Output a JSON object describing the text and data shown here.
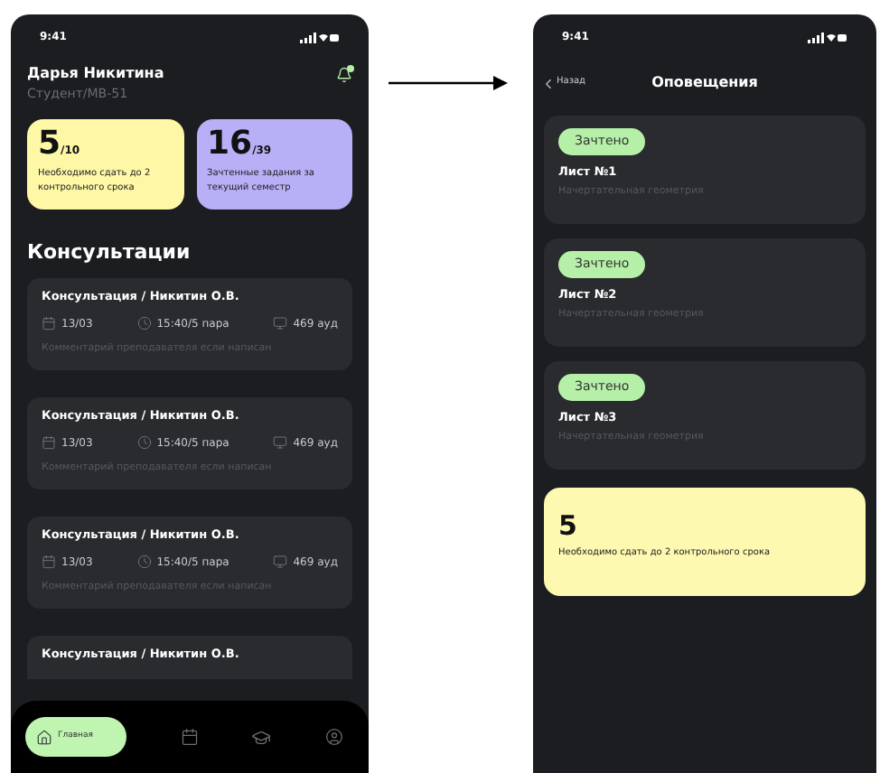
{
  "home_screen": {
    "status_bar": {
      "time": "9:41"
    },
    "profile": {
      "name": "Дарья Никитина",
      "role": "Студент/МВ-51",
      "notification_dot": true
    },
    "stats": [
      {
        "value": "5",
        "total": "/10",
        "caption": "Необходимо сдать до 2 контрольного срока",
        "color": "#fdf7a6"
      },
      {
        "value": "16",
        "total": "/39",
        "caption": "Зачтенные задания за текущий семестр",
        "color": "#b8b0f7"
      }
    ],
    "section_title": "Консультации",
    "consultations": [
      {
        "title": "Консультация / Никитин О.В.",
        "date": "13/03",
        "time": "15:40/5 пара",
        "room": "469 ауд",
        "comment": "Комментарий преподавателя если написан"
      },
      {
        "title": "Консультация / Никитин О.В.",
        "date": "13/03",
        "time": "15:40/5 пара",
        "room": "469 ауд",
        "comment": "Комментарий преподавателя если написан"
      },
      {
        "title": "Консультация / Никитин О.В.",
        "date": "13/03",
        "time": "15:40/5 пара",
        "room": "469 ауд",
        "comment": "Комментарий преподавателя если написан"
      },
      {
        "title": "Консультация / Никитин О.В."
      }
    ],
    "tab_bar": [
      {
        "kind": "home",
        "label": "Главная",
        "selected": true
      },
      {
        "kind": "calendar",
        "selected": false
      },
      {
        "kind": "courses",
        "selected": false
      },
      {
        "kind": "profile",
        "selected": false
      }
    ]
  },
  "notifications_screen": {
    "status_bar": {
      "time": "9:41"
    },
    "back": "Назад",
    "title": "Оповещения",
    "items": [
      {
        "badge": "Зачтено",
        "title": "Лист №1",
        "subtitle": "Начертательная геометрия"
      },
      {
        "badge": "Зачтено",
        "title": "Лист №2",
        "subtitle": "Начертательная геометрия"
      },
      {
        "badge": "Зачтено",
        "title": "Лист №3",
        "subtitle": "Начертательная геометрия"
      }
    ],
    "summary": {
      "value": "5",
      "caption": "Необходимо сдать до 2 контрольного срока",
      "color": "#fdf9b0"
    }
  }
}
